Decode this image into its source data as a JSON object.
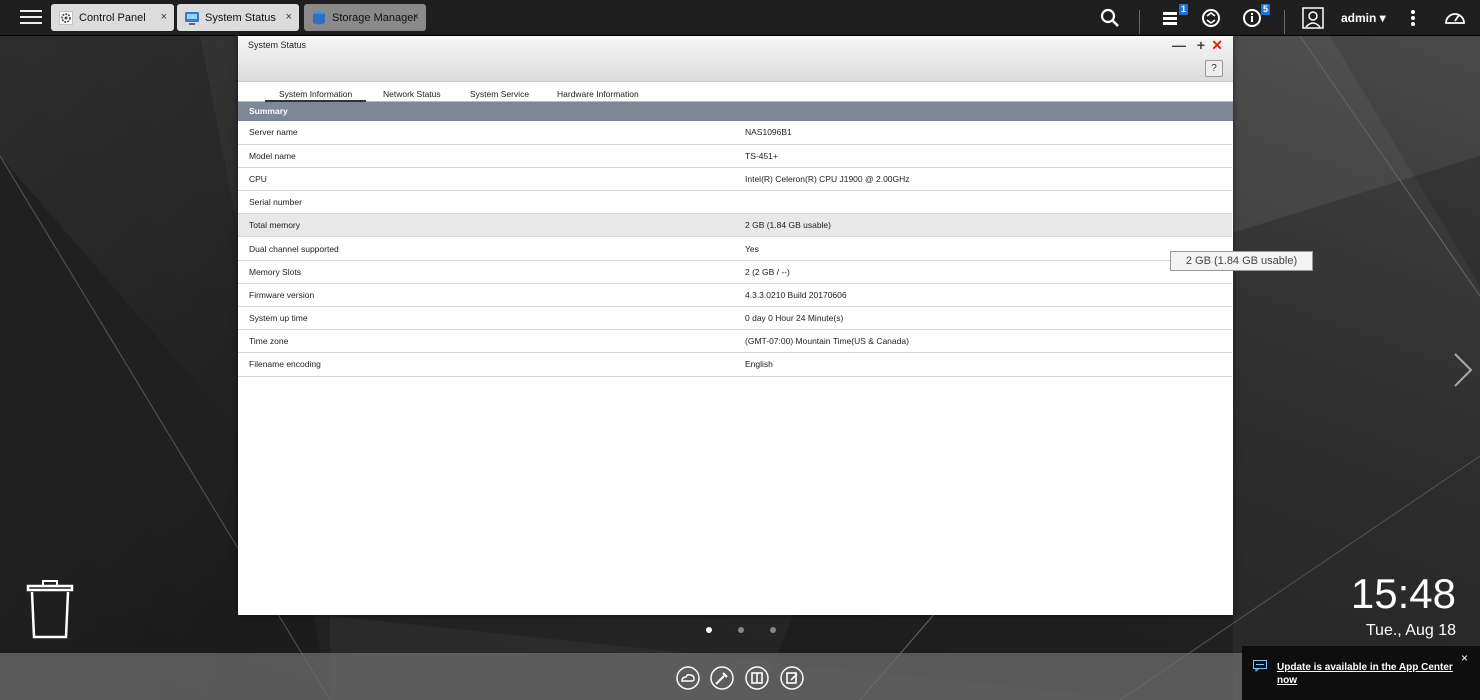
{
  "topbar": {
    "tabs": [
      {
        "label": "Control Panel",
        "icon": "gear-icon",
        "close": "×"
      },
      {
        "label": "System Status",
        "icon": "monitor-icon",
        "close": "×"
      },
      {
        "label": "Storage Manager",
        "icon": "database-icon",
        "close": "×"
      }
    ],
    "badges": {
      "tasks": "1",
      "info": "5"
    },
    "user": "admin ▾"
  },
  "window": {
    "title": "System Status",
    "controls": {
      "minimize": "—",
      "maximize": "+",
      "close": "✕"
    },
    "help": "?",
    "tabs": [
      "System Information",
      "Network Status",
      "System Service",
      "Hardware Information"
    ],
    "section": "Summary",
    "rows": [
      {
        "key": "Server name",
        "value": "NAS1096B1"
      },
      {
        "key": "Model name",
        "value": "TS-451+"
      },
      {
        "key": "CPU",
        "value": "Intel(R) Celeron(R) CPU J1900 @ 2.00GHz"
      },
      {
        "key": "Serial number",
        "value": ""
      },
      {
        "key": "Total memory",
        "value": "2 GB (1.84 GB usable)"
      },
      {
        "key": "Dual channel supported",
        "value": "Yes"
      },
      {
        "key": "Memory Slots",
        "value": "2 (2 GB / --)"
      },
      {
        "key": "Firmware version",
        "value": "4.3.3.0210 Build 20170606"
      },
      {
        "key": "System up time",
        "value": "0 day 0 Hour 24 Minute(s)"
      },
      {
        "key": "Time zone",
        "value": "(GMT-07:00) Mountain Time(US & Canada)"
      },
      {
        "key": "Filename encoding",
        "value": "English"
      }
    ]
  },
  "tooltip": "2 GB (1.84 GB usable)",
  "clock": {
    "time": "15:48",
    "date": "Tue., Aug 18"
  },
  "notification": {
    "message": "Update is available in the App Center now",
    "close": "×"
  },
  "colors": {
    "accent": "#1e73d8",
    "section_header": "#7e8796",
    "close_red": "#d9241f"
  }
}
